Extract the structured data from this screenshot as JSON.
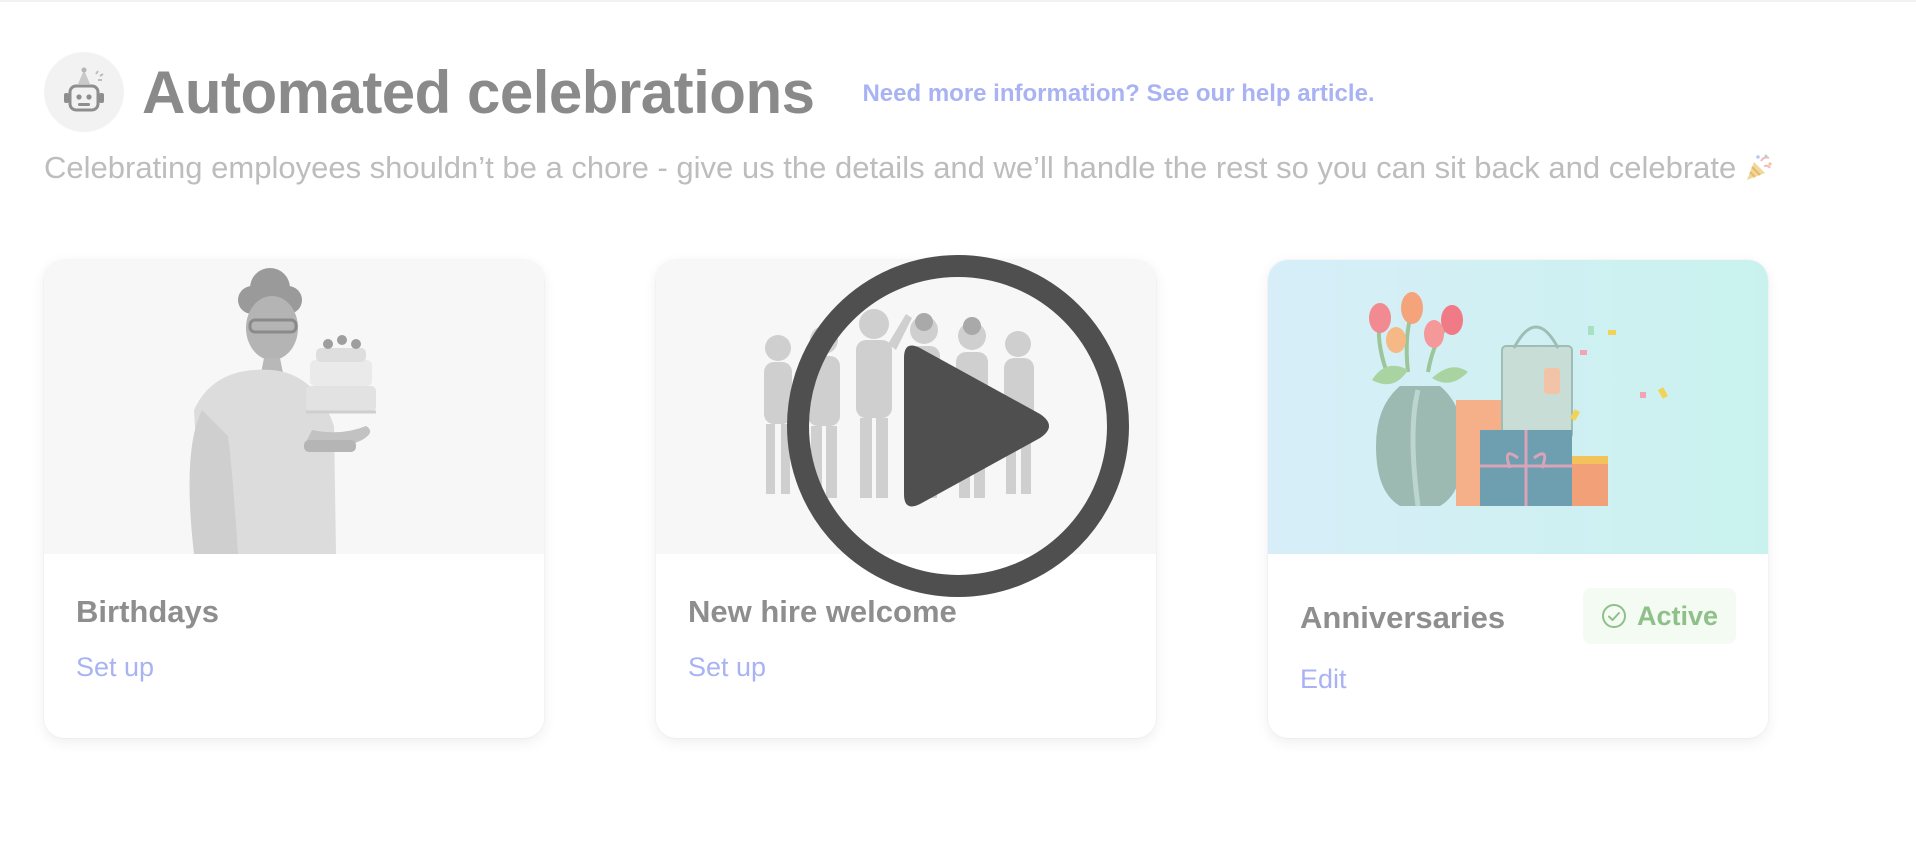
{
  "header": {
    "title": "Automated celebrations",
    "help_link": "Need more information? See our help article.",
    "subtitle": "Celebrating employees shouldn’t be a chore - give us the details and we’ll handle the rest so you can sit back and celebrate"
  },
  "cards": [
    {
      "title": "Birthdays",
      "action": "Set up"
    },
    {
      "title": "New hire welcome",
      "action": "Set up"
    },
    {
      "title": "Anniversaries",
      "action": "Edit",
      "status": "Active"
    }
  ],
  "overlay": {
    "icon": "play-icon"
  },
  "icons": [
    "robot-icon",
    "party-popper-icon",
    "check-circle-icon",
    "play-icon"
  ],
  "colors": {
    "title": "#8a8a8a",
    "link": "#a9b3f4",
    "active": "#8fc08a",
    "active_bg": "#f3fbf2",
    "overlay": "#4f4f4f"
  }
}
